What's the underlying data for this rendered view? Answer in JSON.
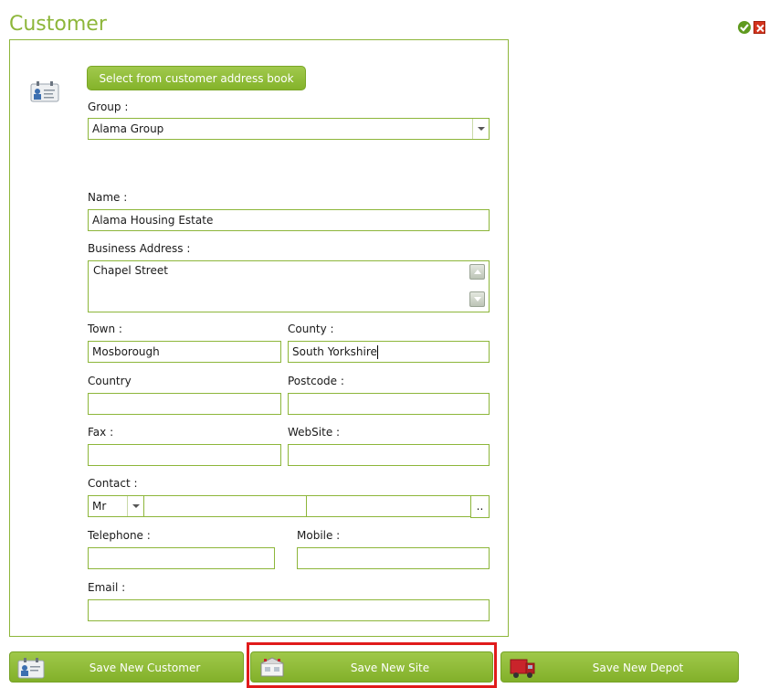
{
  "window": {
    "title": "Customer"
  },
  "form": {
    "address_book_label": "Select from customer address book",
    "group_label": "Group :",
    "group_value": "Alama Group",
    "name_label": "Name :",
    "name_value": "Alama Housing Estate",
    "business_address_label": "Business Address :",
    "business_address_value": "Chapel Street",
    "town_label": "Town :",
    "town_value": "Mosborough",
    "county_label": "County :",
    "county_value": "South Yorkshire",
    "country_label": "Country",
    "country_value": "",
    "postcode_label": "Postcode :",
    "postcode_value": "",
    "fax_label": "Fax :",
    "fax_value": "",
    "website_label": "WebSite :",
    "website_value": "",
    "contact_label": "Contact :",
    "contact_title": "Mr",
    "contact_first": "",
    "contact_last": "",
    "contact_ellipsis": "..",
    "telephone_label": "Telephone :",
    "telephone_value": "",
    "mobile_label": "Mobile :",
    "mobile_value": "",
    "email_label": "Email :",
    "email_value": ""
  },
  "actions": {
    "save_customer": "Save New Customer",
    "save_site": "Save New Site",
    "save_depot": "Save New Depot"
  },
  "colors": {
    "accent": "#8db63a",
    "highlight": "#e01b1b"
  },
  "icons": [
    "ok-icon",
    "close-icon",
    "address-card-icon",
    "site-icon",
    "depot-truck-icon"
  ]
}
